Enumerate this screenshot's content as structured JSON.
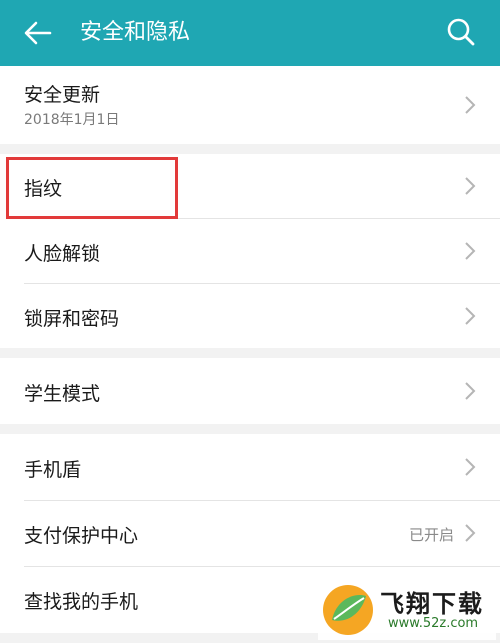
{
  "header": {
    "title": "安全和隐私",
    "back_icon": "arrow-left-icon",
    "search_icon": "search-icon",
    "color": "#1fa7b3"
  },
  "groups": [
    {
      "items": [
        {
          "label": "安全更新",
          "sub": "2018年1月1日"
        }
      ]
    },
    {
      "items": [
        {
          "label": "指纹"
        },
        {
          "label": "人脸解锁"
        },
        {
          "label": "锁屏和密码"
        }
      ]
    },
    {
      "items": [
        {
          "label": "学生模式"
        }
      ]
    },
    {
      "items": [
        {
          "label": "手机盾"
        },
        {
          "label": "支付保护中心",
          "value": "已开启"
        },
        {
          "label": "查找我的手机"
        }
      ]
    }
  ],
  "highlight_color": "#e23a3a",
  "watermark": {
    "name": "飞翔下载",
    "url": "www.52z.com"
  }
}
